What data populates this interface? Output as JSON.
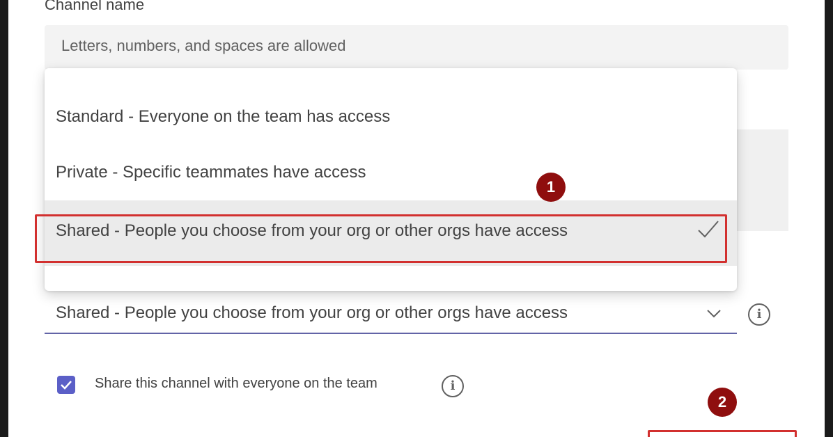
{
  "form": {
    "channel_name_label": "Channel name",
    "channel_name_placeholder": "Letters, numbers, and spaces are allowed"
  },
  "privacy_menu": {
    "options": [
      {
        "label": "Standard - Everyone on the team has access",
        "selected": false
      },
      {
        "label": "Private - Specific teammates have access",
        "selected": false
      },
      {
        "label": "Shared - People you choose from your org or other orgs have access",
        "selected": true
      }
    ]
  },
  "privacy_select": {
    "value": "Shared - People you choose from your org or other orgs have access"
  },
  "share_option": {
    "label": "Share this channel with everyone on the team",
    "checked": true
  },
  "annotations": {
    "step1": "1",
    "step2": "2"
  },
  "icons": {
    "checkmark": "checkmark-icon",
    "chevron": "chevron-down-icon",
    "info": "info-icon"
  },
  "colors": {
    "accent": "#6264a7",
    "checkbox": "#5b5fc7",
    "callout_border": "#d2302f",
    "badge": "#8f0e0e"
  }
}
